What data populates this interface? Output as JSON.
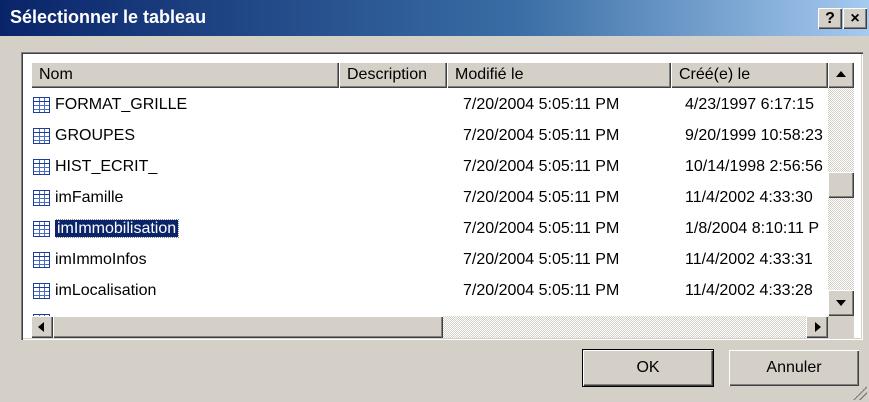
{
  "window": {
    "title": "Sélectionner le tableau",
    "help_btn": "?",
    "close_btn": "×"
  },
  "list": {
    "columns": [
      "Nom",
      "Description",
      "Modifié le",
      "Créé(e) le"
    ],
    "rows": [
      {
        "name": "FORMAT_GRILLE",
        "description": "",
        "modified": "7/20/2004 5:05:11 PM",
        "created": "4/23/1997 6:17:15"
      },
      {
        "name": "GROUPES",
        "description": "",
        "modified": "7/20/2004 5:05:11 PM",
        "created": "9/20/1999 10:58:23"
      },
      {
        "name": "HIST_ECRIT_",
        "description": "",
        "modified": "7/20/2004 5:05:11 PM",
        "created": "10/14/1998 2:56:56"
      },
      {
        "name": "imFamille",
        "description": "",
        "modified": "7/20/2004 5:05:11 PM",
        "created": "11/4/2002 4:33:30"
      },
      {
        "name": "imImmobilisation",
        "description": "",
        "modified": "7/20/2004 5:05:11 PM",
        "created": "1/8/2004 8:10:11 P"
      },
      {
        "name": "imImmoInfos",
        "description": "",
        "modified": "7/20/2004 5:05:11 PM",
        "created": "11/4/2002 4:33:31"
      },
      {
        "name": "imLocalisation",
        "description": "",
        "modified": "7/20/2004 5:05:11 PM",
        "created": "11/4/2002 4:33:28"
      }
    ],
    "selected_index": 4
  },
  "buttons": {
    "ok": "OK",
    "cancel": "Annuler"
  },
  "icons": {
    "row_icon": "table-icon",
    "scroll_up": "arrow-up-icon",
    "scroll_down": "arrow-down-icon",
    "scroll_left": "arrow-left-icon",
    "scroll_right": "arrow-right-icon"
  },
  "colors": {
    "title_start": "#0a246a",
    "title_end": "#a6caf0",
    "selection": "#0a246a",
    "face": "#d4d0c8"
  }
}
